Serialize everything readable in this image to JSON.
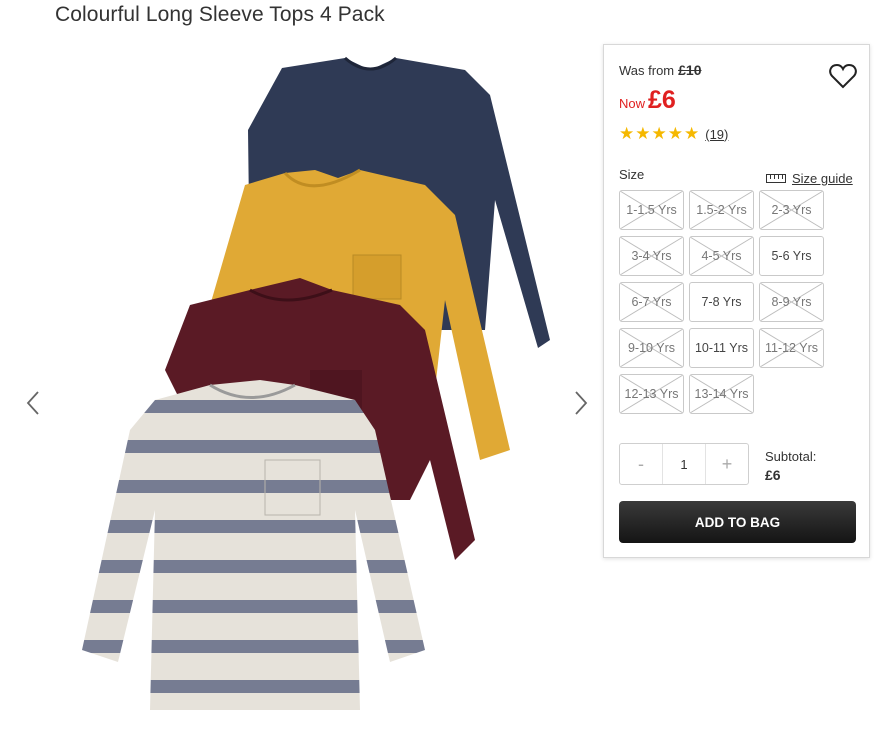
{
  "product": {
    "title": "Colourful Long Sleeve Tops 4 Pack",
    "was_label": "Was from",
    "was_price": "£10",
    "now_label": "Now",
    "now_price": "£6",
    "rating": 5,
    "reviews": "(19)"
  },
  "size": {
    "label": "Size",
    "guide_label": "Size guide",
    "options": [
      {
        "label": "1-1.5 Yrs",
        "available": false
      },
      {
        "label": "1.5-2 Yrs",
        "available": false
      },
      {
        "label": "2-3 Yrs",
        "available": false
      },
      {
        "label": "3-4 Yrs",
        "available": false
      },
      {
        "label": "4-5 Yrs",
        "available": false
      },
      {
        "label": "5-6 Yrs",
        "available": true
      },
      {
        "label": "6-7 Yrs",
        "available": false
      },
      {
        "label": "7-8 Yrs",
        "available": true
      },
      {
        "label": "8-9 Yrs",
        "available": false
      },
      {
        "label": "9-10 Yrs",
        "available": false
      },
      {
        "label": "10-11 Yrs",
        "available": true
      },
      {
        "label": "11-12 Yrs",
        "available": false
      },
      {
        "label": "12-13 Yrs",
        "available": false
      },
      {
        "label": "13-14 Yrs",
        "available": false
      }
    ]
  },
  "quantity": {
    "minus": "-",
    "value": "1",
    "plus": "+"
  },
  "subtotal": {
    "label": "Subtotal:",
    "amount": "£6"
  },
  "cta": {
    "add_to_bag": "ADD TO BAG"
  },
  "colors": {
    "price_red": "#e02020",
    "star": "#f5b800",
    "button": "#1e1e1e",
    "tops": [
      "#2f3a55",
      "#e0a935",
      "#5a1a25",
      "#e6e2da"
    ]
  },
  "icons": {
    "prev": "chevron-left-icon",
    "next": "chevron-right-icon",
    "wishlist": "heart-icon",
    "size_guide": "ruler-icon"
  }
}
